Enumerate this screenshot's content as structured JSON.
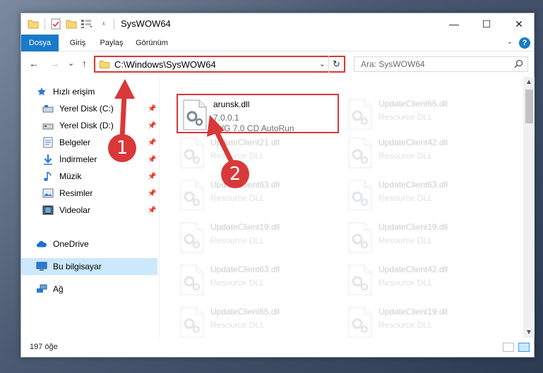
{
  "window": {
    "title": "SysWOW64",
    "minimize_label": "—",
    "maximize_label": "☐",
    "close_label": "✕"
  },
  "ribbon": {
    "tabs": [
      {
        "label": "Dosya"
      },
      {
        "label": "Giriş"
      },
      {
        "label": "Paylaş"
      },
      {
        "label": "Görünüm"
      }
    ],
    "help_label": "?"
  },
  "navbar": {
    "back_label": "←",
    "forward_label": "→",
    "recent_label": "⌄",
    "up_label": "↑",
    "address_path": "C:\\Windows\\SysWOW64",
    "search_placeholder": "Ara: SysWOW64"
  },
  "sidebar": {
    "items": [
      {
        "label": "Hızlı erişim",
        "icon": "star-icon"
      },
      {
        "label": "Yerel Disk (C:)",
        "icon": "drive-icon",
        "pinned": true
      },
      {
        "label": "Yerel Disk (D:)",
        "icon": "drive-icon",
        "pinned": true
      },
      {
        "label": "Belgeler",
        "icon": "documents-icon",
        "pinned": true
      },
      {
        "label": "İndirmeler",
        "icon": "download-icon",
        "pinned": true
      },
      {
        "label": "Müzik",
        "icon": "music-icon",
        "pinned": true
      },
      {
        "label": "Resimler",
        "icon": "pictures-icon",
        "pinned": true
      },
      {
        "label": "Videolar",
        "icon": "videos-icon",
        "pinned": true
      },
      {
        "label": "OneDrive",
        "icon": "cloud-icon"
      },
      {
        "label": "Bu bilgisayar",
        "icon": "computer-icon",
        "selected": true
      },
      {
        "label": "Ağ",
        "icon": "network-icon"
      }
    ]
  },
  "files": [
    {
      "name": "arunsk.dll",
      "line2": "7.0.0.1",
      "line3": "AVG 7.0 CD AutoRun",
      "highlighted": true
    },
    {
      "name": "UpdateClient65.dll",
      "line2": "Resource DLL"
    },
    {
      "name": "UpdateClient21.dll",
      "line2": "Resource DLL"
    },
    {
      "name": "UpdateClient42.dll",
      "line2": "Resource DLL"
    },
    {
      "name": "UpdateClient63.dll",
      "line2": "Resource DLL"
    },
    {
      "name": "UpdateClient63.dll",
      "line2": "Resource DLL"
    },
    {
      "name": "UpdateClient19.dll",
      "line2": "Resource DLL"
    },
    {
      "name": "UpdateClient19.dll",
      "line2": "Resource DLL"
    },
    {
      "name": "UpdateClient63.dll",
      "line2": "Resource DLL"
    },
    {
      "name": "UpdateClient42.dll",
      "line2": "Resource DLL"
    },
    {
      "name": "UpdateClient65.dll",
      "line2": "Resource DLL"
    },
    {
      "name": "UpdateClient19.dll",
      "line2": "Resource DLL"
    }
  ],
  "statusbar": {
    "item_count": "197 öğe"
  },
  "annotations": {
    "step1": "1",
    "step2": "2",
    "color": "#d9383a"
  }
}
